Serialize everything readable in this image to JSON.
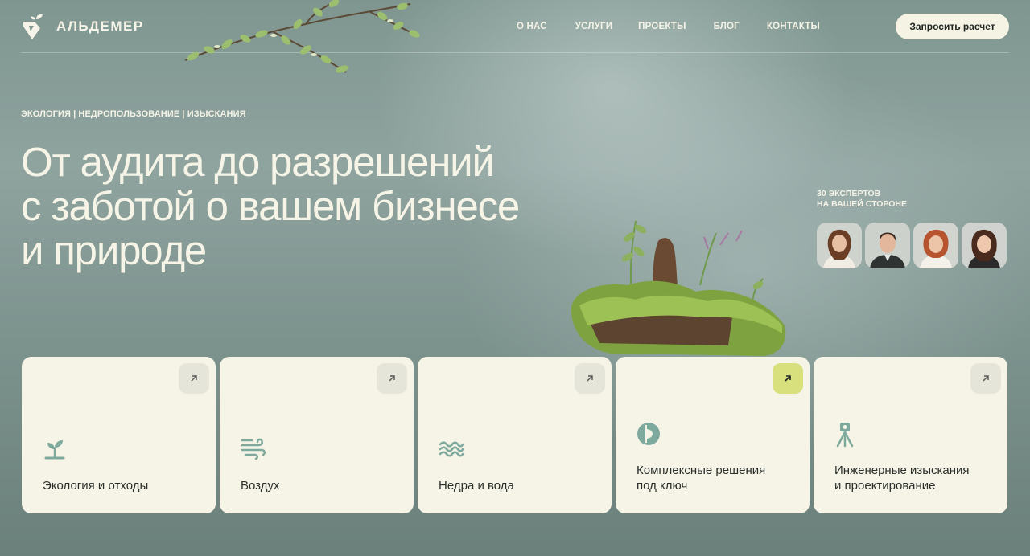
{
  "header": {
    "logo_text": "АЛЬДЕМЕР",
    "nav": [
      "О НАС",
      "УСЛУГИ",
      "ПРОЕКТЫ",
      "БЛОГ",
      "КОНТАКТЫ"
    ],
    "cta_label": "Запросить расчет"
  },
  "hero": {
    "tagline": "ЭКОЛОГИЯ | НЕДРОПОЛЬЗОВАНИЕ | ИЗЫСКАНИЯ",
    "headline_lines": [
      "От аудита до разрешений",
      "с заботой о вашем бизнесе",
      "и природе"
    ],
    "experts_label_lines": [
      "30 ЭКСПЕРТОВ",
      "НА ВАШЕЙ СТОРОНЕ"
    ]
  },
  "cards": [
    {
      "title_lines": [
        "Экология и отходы"
      ],
      "icon": "sprout-icon"
    },
    {
      "title_lines": [
        "Воздух"
      ],
      "icon": "wind-icon"
    },
    {
      "title_lines": [
        "Недра и вода"
      ],
      "icon": "waves-icon"
    },
    {
      "title_lines": [
        "Комплексные решения",
        "под ключ"
      ],
      "icon": "circle-half-icon"
    },
    {
      "title_lines": [
        "Инженерные изыскания",
        "и проектирование"
      ],
      "icon": "tripod-icon"
    }
  ],
  "colors": {
    "background": "#7f9690",
    "card": "#f6f4e6",
    "accent": "#d7e07d",
    "icon": "#7ea99d"
  }
}
